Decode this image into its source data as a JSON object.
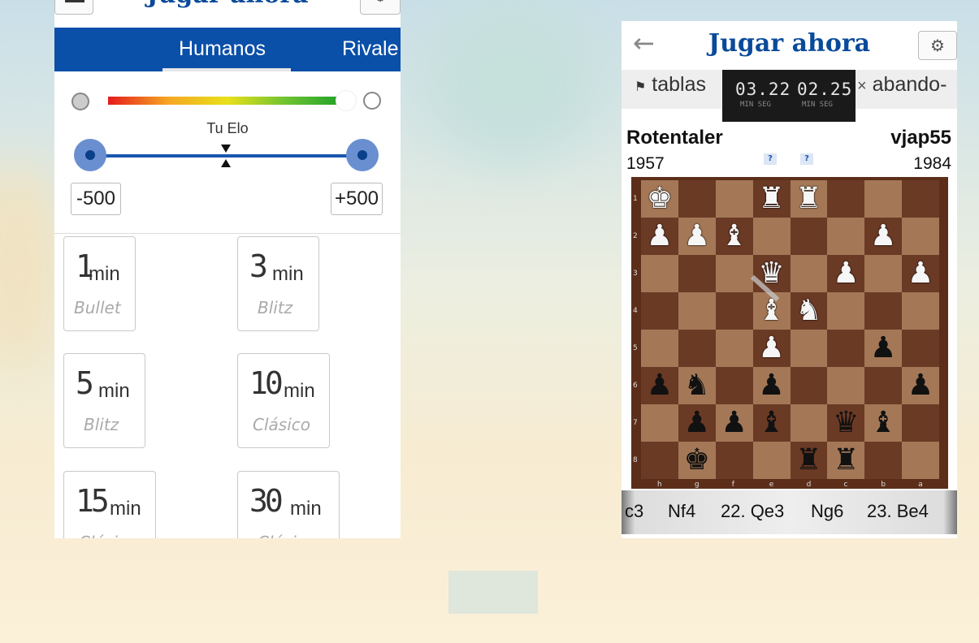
{
  "left_panel": {
    "title": "Jugar ahora",
    "tabs": [
      {
        "label": "Humanos",
        "active": true
      },
      {
        "label": "Rivale",
        "active": false
      }
    ],
    "elo_label": "Tu Elo",
    "range_min": "-500",
    "range_max": "+500",
    "time_controls": [
      {
        "num": "1",
        "unit": "min",
        "kind": "Bullet"
      },
      {
        "num": "3",
        "unit": "min",
        "kind": "Blitz"
      },
      {
        "num": "5",
        "unit": "min",
        "kind": "Blitz"
      },
      {
        "num": "10",
        "unit": "min",
        "kind": "Clásico"
      },
      {
        "num": "15",
        "unit": "min",
        "kind": "Clásico"
      },
      {
        "num": "30",
        "unit": "min",
        "kind": "Clásico"
      }
    ]
  },
  "right_panel": {
    "title": "Jugar ahora",
    "draw_label": "tablas",
    "resign_label": "abando-",
    "clock_white": "03.22",
    "clock_black": "02.25",
    "clock_sub": "MIN SEG",
    "player_left": {
      "name": "Rotentaler",
      "rating": "1957"
    },
    "player_right": {
      "name": "vjap55",
      "rating": "1984"
    },
    "q_mark": "?",
    "ranks": [
      "1",
      "2",
      "3",
      "4",
      "5",
      "6",
      "7",
      "8"
    ],
    "files": [
      "h",
      "g",
      "f",
      "e",
      "d",
      "c",
      "b",
      "a"
    ],
    "board": [
      [
        "wK",
        "",
        "",
        "wR",
        "wR",
        "",
        "",
        ""
      ],
      [
        "wP",
        "wP",
        "wB",
        "",
        "",
        "",
        "wP",
        ""
      ],
      [
        "",
        "",
        "",
        "wQ",
        "",
        "wP",
        "",
        "wP"
      ],
      [
        "",
        "",
        "",
        "wB",
        "wN",
        "",
        "",
        ""
      ],
      [
        "",
        "",
        "",
        "wP",
        "",
        "",
        "bP",
        ""
      ],
      [
        "bP",
        "bN",
        "",
        "bP",
        "",
        "",
        "",
        "bP"
      ],
      [
        "",
        "bP",
        "bP",
        "bB",
        "",
        "bQ",
        "bB",
        ""
      ],
      [
        "",
        "bK",
        "",
        "",
        "bR",
        "bR",
        "",
        ""
      ]
    ],
    "moves": [
      "c3",
      "Nf4",
      "22. Qe3",
      "Ng6",
      "23. Be4"
    ]
  },
  "colors": {
    "brand_blue": "#0a4a9a",
    "tab_blue": "#0a4fa8"
  }
}
